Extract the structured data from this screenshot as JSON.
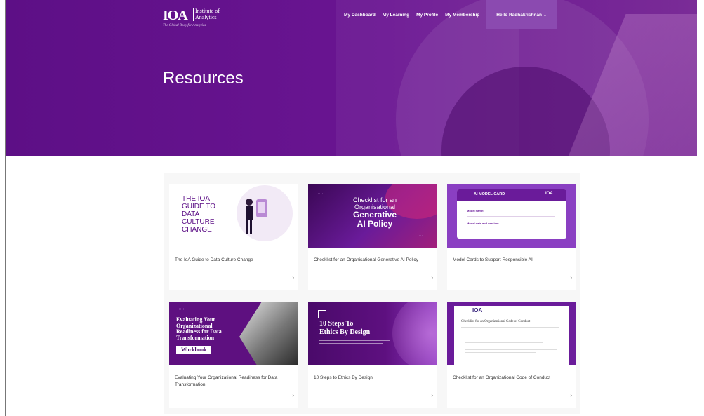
{
  "header": {
    "logo": {
      "mark": "IOA",
      "line1": "Institute of",
      "line2": "Analytics",
      "tagline": "The Global Body for Analytics"
    },
    "nav": [
      {
        "label": "My Dashboard"
      },
      {
        "label": "My Learning"
      },
      {
        "label": "My Profile"
      },
      {
        "label": "My Membership"
      }
    ],
    "user_menu": {
      "label": "Hello Radhakrishnan ⌄"
    }
  },
  "hero": {
    "title": "Resources"
  },
  "colors": {
    "brand_purple": "#5d0f86",
    "accent_purple": "#8b4ab0",
    "card_purple": "#6a1b9a"
  },
  "cards": [
    {
      "title": "The IoA Guide to Data Culture Change",
      "thumb": {
        "l1": "THE IOA",
        "l2": "GUIDE TO",
        "l3": "DATA",
        "l4": "CULTURE",
        "l5": "CHANGE"
      }
    },
    {
      "title": "Checklist for an Organisational Generative AI Policy",
      "thumb": {
        "l1": "Checklist for an",
        "l2": "Organisational",
        "l3": "Generative",
        "l4": "AI Policy"
      }
    },
    {
      "title": "Model Cards to Support Responsible AI",
      "thumb": {
        "heading": "AI MODEL CARD",
        "badge": "IOA",
        "f1": "Model name:",
        "f2": "Model date and version:"
      }
    },
    {
      "title": "Evaluating Your Organizational Readiness for Data Transformation",
      "thumb": {
        "l1": "Evaluating Your",
        "l2": "Organizational",
        "l3": "Readiness for Data",
        "l4": "Transformation",
        "tag": "Workbook"
      }
    },
    {
      "title": "10 Steps to Ethics By Design",
      "thumb": {
        "l1": "10 Steps To",
        "l2": "Ethics By Design"
      }
    },
    {
      "title": "Checklist for an Organizational Code of Conduct",
      "thumb": {
        "badge": "IOA",
        "heading": "Checklist for an Organizational Code of Conduct"
      }
    }
  ],
  "arrow_glyph": "›"
}
